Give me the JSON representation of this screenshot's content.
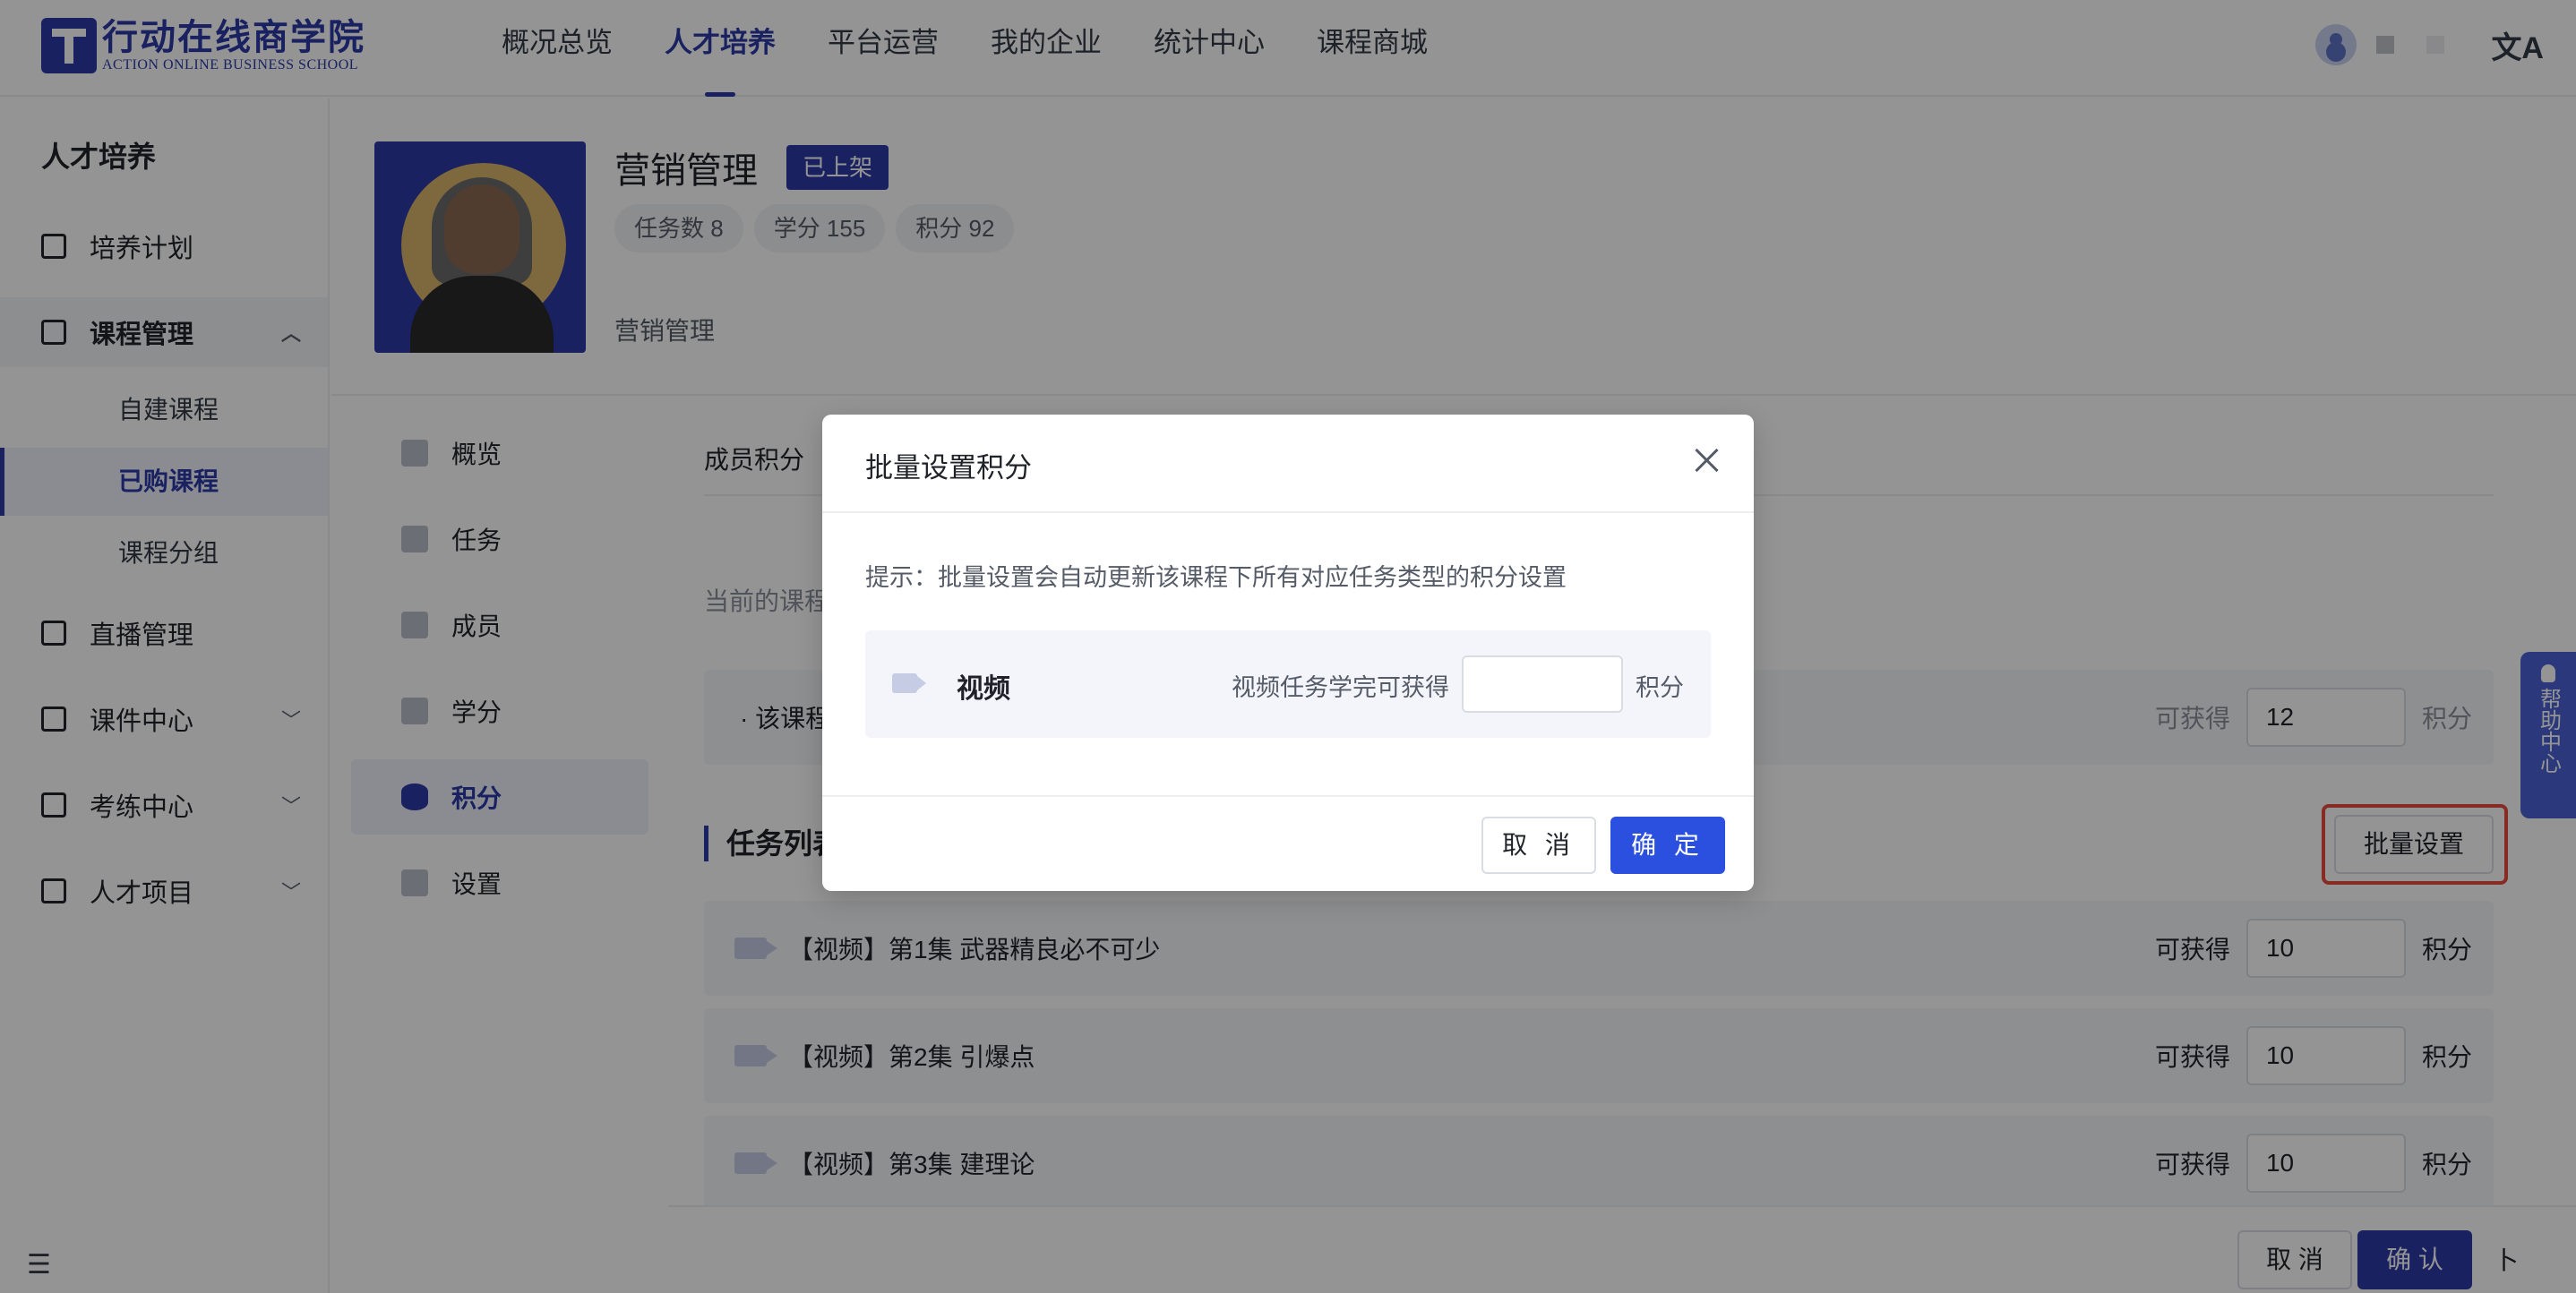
{
  "brand": {
    "name_cn": "行动在线商学院",
    "name_en": "ACTION ONLINE BUSINESS SCHOOL",
    "color": "#2b3aa8"
  },
  "top_nav": {
    "items": [
      "概况总览",
      "人才培养",
      "平台运营",
      "我的企业",
      "统计中心",
      "课程商城"
    ],
    "active_index": 1,
    "translate_icon": "文A"
  },
  "sidebar": {
    "title": "人才培养",
    "items": [
      {
        "label": "培养计划",
        "icon": "calendar-icon"
      },
      {
        "label": "课程管理",
        "icon": "book-icon",
        "expanded": true
      },
      {
        "label": "直播管理",
        "icon": "video-icon"
      },
      {
        "label": "课件中心",
        "icon": "inbox-icon"
      },
      {
        "label": "考练中心",
        "icon": "edit-icon"
      },
      {
        "label": "人才项目",
        "icon": "project-icon"
      }
    ],
    "sub_items": [
      "自建课程",
      "已购课程",
      "课程分组"
    ],
    "active_sub": "已购课程"
  },
  "course": {
    "title": "营销管理",
    "status": "已上架",
    "stats": [
      "任务数 8",
      "学分 155",
      "积分 92"
    ],
    "subtitle": "营销管理"
  },
  "inner_nav": {
    "items": [
      "概览",
      "任务",
      "成员",
      "学分",
      "积分",
      "设置"
    ],
    "active": "积分"
  },
  "main": {
    "tab": "成员积分",
    "current_text": "当前的课程",
    "course_rule_label": "· 该课程",
    "course_rule_value": "12",
    "get_label": "可获得",
    "unit_label": "积分",
    "list_title": "任务列表",
    "batch_button": "批量设置",
    "tasks": [
      {
        "label": "【视频】第1集 武器精良必不可少",
        "value": "10"
      },
      {
        "label": "【视频】第2集 引爆点",
        "value": "10"
      },
      {
        "label": "【视频】第3集 建理论",
        "value": "10"
      }
    ]
  },
  "help": {
    "label": "帮助中心"
  },
  "bottom_bar": {
    "cancel": "取 消",
    "confirm": "确 认",
    "arrow": "卜"
  },
  "modal": {
    "title": "批量设置积分",
    "tip": "提示：批量设置会自动更新该课程下所有对应任务类型的积分设置",
    "row_label": "视频",
    "row_text": "视频任务学完可获得",
    "row_unit": "积分",
    "row_value": "",
    "cancel": "取 消",
    "confirm": "确 定"
  }
}
